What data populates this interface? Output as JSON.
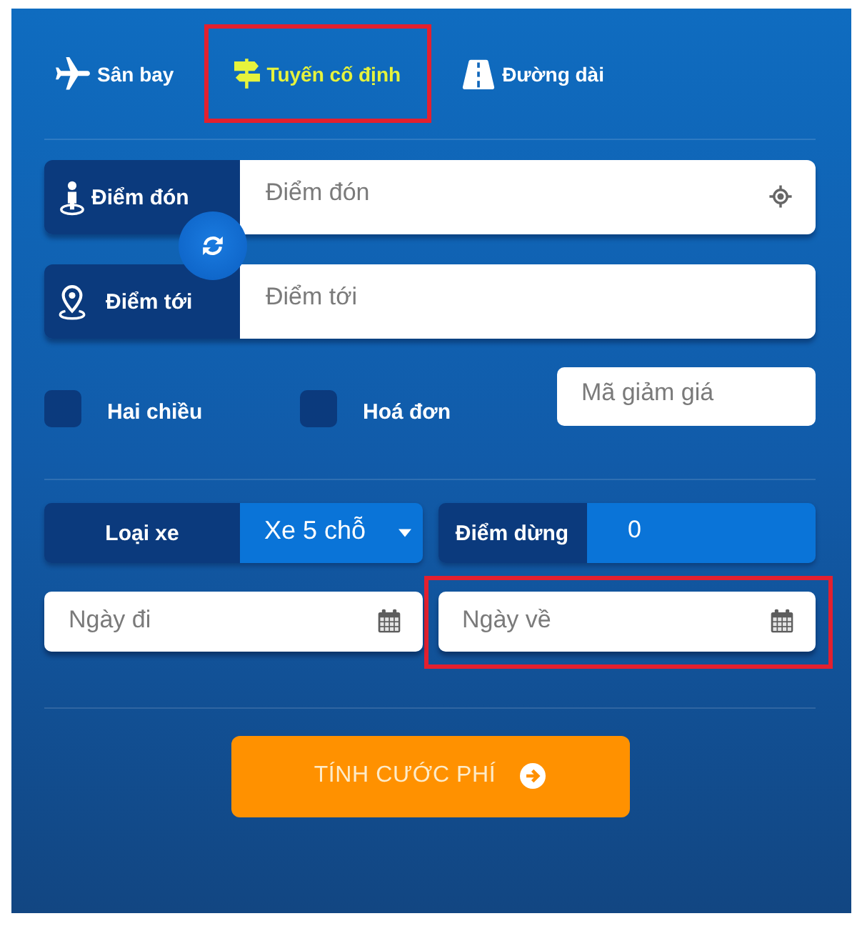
{
  "tabs": [
    {
      "label": "Sân bay",
      "kind": "airport",
      "selected": false,
      "highlighted": false
    },
    {
      "label": "Tuyến cố định",
      "kind": "route",
      "selected": true,
      "highlighted": true
    },
    {
      "label": "Đường dài",
      "kind": "highway",
      "selected": false,
      "highlighted": false
    }
  ],
  "route": [
    {
      "kind": "pickup",
      "label": "Điểm đón",
      "placeholder": "Điểm đón"
    },
    {
      "kind": "destination",
      "label": "Điểm tới",
      "placeholder": "Điểm tới"
    }
  ],
  "options": [
    {
      "label": "Hai chiều",
      "checked": false
    },
    {
      "label": "Hoá đơn",
      "checked": false
    }
  ],
  "discount": {
    "placeholder": "Mã giảm giá"
  },
  "vehicle": {
    "label": "Loại xe",
    "value": "Xe 5 chỗ"
  },
  "stops": {
    "label": "Điểm dừng",
    "value": "0"
  },
  "dates": [
    {
      "placeholder": "Ngày đi",
      "highlighted": false
    },
    {
      "placeholder": "Ngày về",
      "highlighted": true
    }
  ],
  "submit": {
    "label": "TÍNH CƯỚC PHÍ"
  }
}
